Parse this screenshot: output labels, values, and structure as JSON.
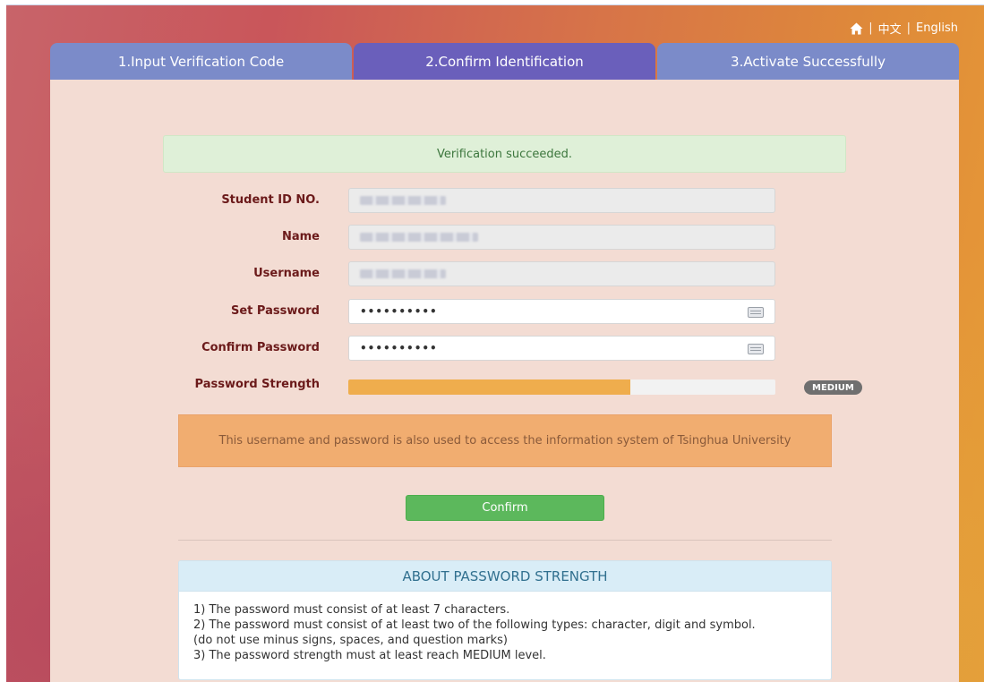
{
  "topnav": {
    "home_icon": "home-icon",
    "lang_zh": "中文",
    "lang_en": "English",
    "separator": "|"
  },
  "tabs": [
    {
      "label": "1.Input Verification Code",
      "active": false
    },
    {
      "label": "2.Confirm Identification",
      "active": true
    },
    {
      "label": "3.Activate Successfully",
      "active": false
    }
  ],
  "alert": {
    "text": "Verification succeeded."
  },
  "form": {
    "student_id_label": "Student ID NO.",
    "name_label": "Name",
    "username_label": "Username",
    "set_password_label": "Set Password",
    "set_password_value": "••••••••••",
    "confirm_password_label": "Confirm Password",
    "confirm_password_value": "••••••••••",
    "strength_label": "Password Strength",
    "strength_level": "MEDIUM",
    "strength_fill_percent": 66
  },
  "notice": {
    "text": "This username and password is also used to access the information system of Tsinghua University"
  },
  "confirm_button": {
    "label": "Confirm"
  },
  "about": {
    "title": "ABOUT PASSWORD STRENGTH",
    "rules": [
      "1) The password must consist of at least 7 characters.",
      "2) The password must consist of at least two of the following types: character, digit and symbol.",
      "(do not use minus signs, spaces, and question marks)",
      "3) The password strength must at least reach MEDIUM level."
    ]
  },
  "colors": {
    "tab_inactive": "#7b8bc9",
    "tab_active": "#6a5fbb",
    "panel_bg": "#f3dcd3",
    "success_bg": "#dff0d8",
    "notice_bg": "#f1ad70",
    "confirm_btn": "#5cb85c",
    "strength_fill": "#efad4d"
  }
}
